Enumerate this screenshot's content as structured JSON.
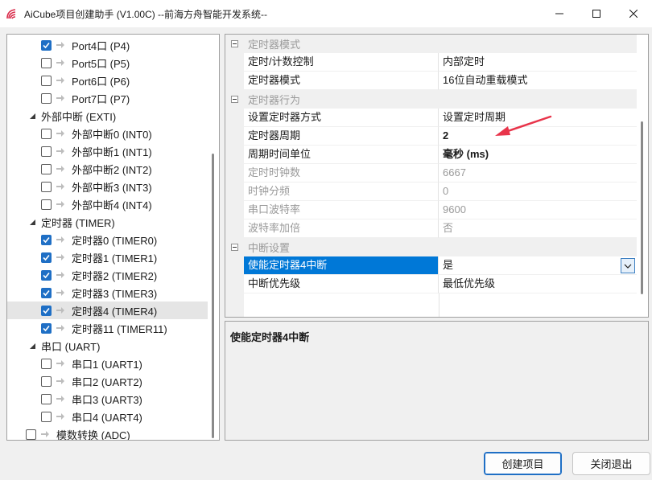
{
  "window": {
    "title": "AiCube项目创建助手 (V1.00C) --前海方舟智能开发系统--"
  },
  "tree": {
    "items": [
      {
        "label": "Port4口 (P4)",
        "level": 2,
        "checked": true,
        "type": "leaf"
      },
      {
        "label": "Port5口 (P5)",
        "level": 2,
        "checked": false,
        "type": "leaf"
      },
      {
        "label": "Port6口 (P6)",
        "level": 2,
        "checked": false,
        "type": "leaf"
      },
      {
        "label": "Port7口 (P7)",
        "level": 2,
        "checked": false,
        "type": "leaf"
      },
      {
        "label": "外部中断 (EXTI)",
        "level": 1,
        "type": "group"
      },
      {
        "label": "外部中断0 (INT0)",
        "level": 2,
        "checked": false,
        "type": "leaf"
      },
      {
        "label": "外部中断1 (INT1)",
        "level": 2,
        "checked": false,
        "type": "leaf"
      },
      {
        "label": "外部中断2 (INT2)",
        "level": 2,
        "checked": false,
        "type": "leaf"
      },
      {
        "label": "外部中断3 (INT3)",
        "level": 2,
        "checked": false,
        "type": "leaf"
      },
      {
        "label": "外部中断4 (INT4)",
        "level": 2,
        "checked": false,
        "type": "leaf"
      },
      {
        "label": "定时器 (TIMER)",
        "level": 1,
        "type": "group"
      },
      {
        "label": "定时器0 (TIMER0)",
        "level": 2,
        "checked": true,
        "type": "leaf"
      },
      {
        "label": "定时器1 (TIMER1)",
        "level": 2,
        "checked": true,
        "type": "leaf"
      },
      {
        "label": "定时器2 (TIMER2)",
        "level": 2,
        "checked": true,
        "type": "leaf"
      },
      {
        "label": "定时器3 (TIMER3)",
        "level": 2,
        "checked": true,
        "type": "leaf"
      },
      {
        "label": "定时器4 (TIMER4)",
        "level": 2,
        "checked": true,
        "type": "leaf",
        "selected": true
      },
      {
        "label": "定时器11 (TIMER11)",
        "level": 2,
        "checked": true,
        "type": "leaf"
      },
      {
        "label": "串口 (UART)",
        "level": 1,
        "type": "group"
      },
      {
        "label": "串口1 (UART1)",
        "level": 2,
        "checked": false,
        "type": "leaf"
      },
      {
        "label": "串口2 (UART2)",
        "level": 2,
        "checked": false,
        "type": "leaf"
      },
      {
        "label": "串口3 (UART3)",
        "level": 2,
        "checked": false,
        "type": "leaf"
      },
      {
        "label": "串口4 (UART4)",
        "level": 2,
        "checked": false,
        "type": "leaf"
      },
      {
        "label": "模数转换 (ADC)",
        "level": 0,
        "checked": false,
        "type": "leaf"
      }
    ]
  },
  "properties": {
    "rows": [
      {
        "kind": "category",
        "label": "定时器模式"
      },
      {
        "kind": "prop",
        "name": "定时/计数控制",
        "value": "内部定时"
      },
      {
        "kind": "prop",
        "name": "定时器模式",
        "value": "16位自动重载模式"
      },
      {
        "kind": "category",
        "label": "定时器行为"
      },
      {
        "kind": "prop",
        "name": "设置定时器方式",
        "value": "设置定时周期"
      },
      {
        "kind": "prop",
        "name": "定时器周期",
        "value": "2",
        "bold": true
      },
      {
        "kind": "prop",
        "name": "周期时间单位",
        "value": "毫秒 (ms)",
        "bold": true
      },
      {
        "kind": "prop",
        "name": "定时时钟数",
        "value": "6667",
        "disabled": true
      },
      {
        "kind": "prop",
        "name": "时钟分频",
        "value": "0",
        "disabled": true
      },
      {
        "kind": "prop",
        "name": "串口波特率",
        "value": "9600",
        "disabled": true
      },
      {
        "kind": "prop",
        "name": "波特率加倍",
        "value": "否",
        "disabled": true
      },
      {
        "kind": "category",
        "label": "中断设置"
      },
      {
        "kind": "prop",
        "name": "使能定时器4中断",
        "value": "是",
        "selected": true,
        "dropdown": true
      },
      {
        "kind": "prop",
        "name": "中断优先级",
        "value": "最低优先级"
      }
    ]
  },
  "description": {
    "title": "使能定时器4中断"
  },
  "buttons": {
    "create": "创建项目",
    "close": "关闭退出"
  },
  "colors": {
    "accent": "#0078d7",
    "checkbox_checked": "#1f6fc5",
    "annotation_arrow": "#e8344a"
  }
}
